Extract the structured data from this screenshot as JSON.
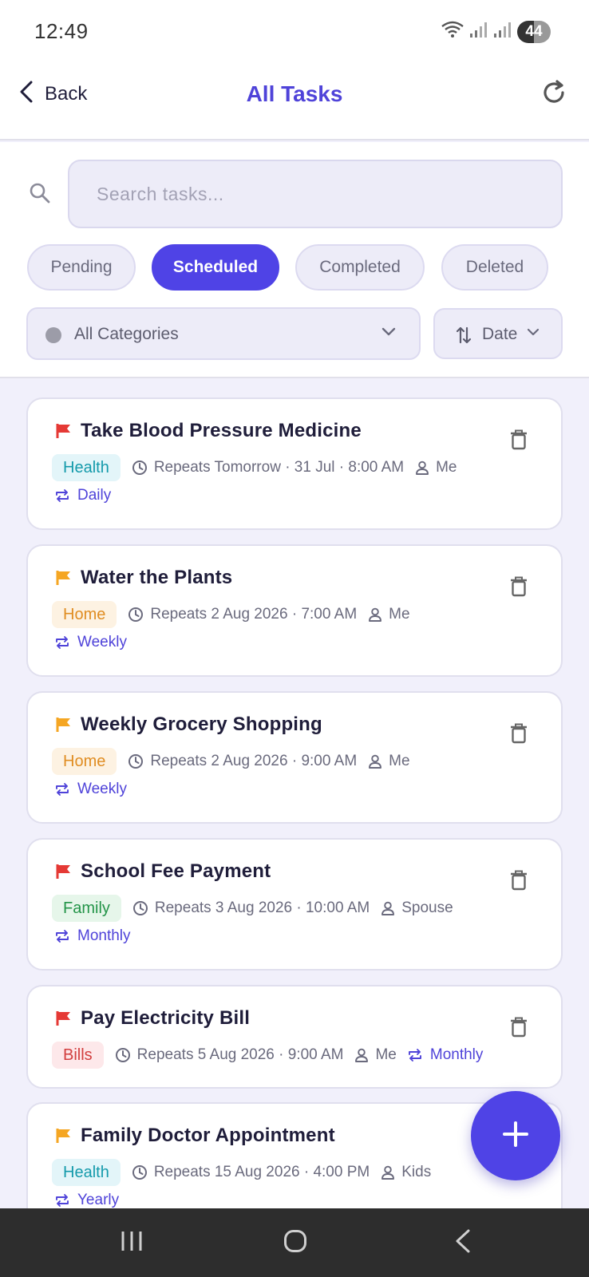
{
  "status_bar": {
    "time": "12:49",
    "battery": "44"
  },
  "header": {
    "back_label": "Back",
    "title": "All Tasks"
  },
  "search": {
    "placeholder": "Search tasks..."
  },
  "tabs": [
    {
      "label": "Pending",
      "active": false
    },
    {
      "label": "Scheduled",
      "active": true
    },
    {
      "label": "Completed",
      "active": false
    },
    {
      "label": "Deleted",
      "active": false
    }
  ],
  "category_filter": {
    "label": "All Categories"
  },
  "sort": {
    "label": "Date"
  },
  "tasks": [
    {
      "title": "Take Blood Pressure Medicine",
      "priority": "high",
      "category": "Health",
      "schedule": "Repeats Tomorrow · 31 Jul · 8:00 AM",
      "assignee": "Me",
      "repeat": "Daily"
    },
    {
      "title": "Water the Plants",
      "priority": "medium",
      "category": "Home",
      "schedule": "Repeats 2 Aug 2026 · 7:00 AM",
      "assignee": "Me",
      "repeat": "Weekly"
    },
    {
      "title": "Weekly Grocery Shopping",
      "priority": "medium",
      "category": "Home",
      "schedule": "Repeats 2 Aug 2026 · 9:00 AM",
      "assignee": "Me",
      "repeat": "Weekly"
    },
    {
      "title": "School Fee Payment",
      "priority": "high",
      "category": "Family",
      "schedule": "Repeats 3 Aug 2026 · 10:00 AM",
      "assignee": "Spouse",
      "repeat": "Monthly"
    },
    {
      "title": "Pay Electricity Bill",
      "priority": "high",
      "category": "Bills",
      "schedule": "Repeats 5 Aug 2026 · 9:00 AM",
      "assignee": "Me",
      "repeat": "Monthly"
    },
    {
      "title": "Family Doctor Appointment",
      "priority": "medium",
      "category": "Health",
      "schedule": "Repeats 15 Aug 2026 · 4:00 PM",
      "assignee": "Kids",
      "repeat": "Yearly"
    }
  ],
  "colors": {
    "accent": "#4f43e6",
    "flag_high": "#e53935",
    "flag_medium": "#f5a623"
  },
  "icons": [
    "back-chevron-icon",
    "refresh-icon",
    "search-icon",
    "sort-icon",
    "chevron-down-icon",
    "flag-icon",
    "clock-icon",
    "person-icon",
    "repeat-icon",
    "trash-icon",
    "plus-icon"
  ]
}
